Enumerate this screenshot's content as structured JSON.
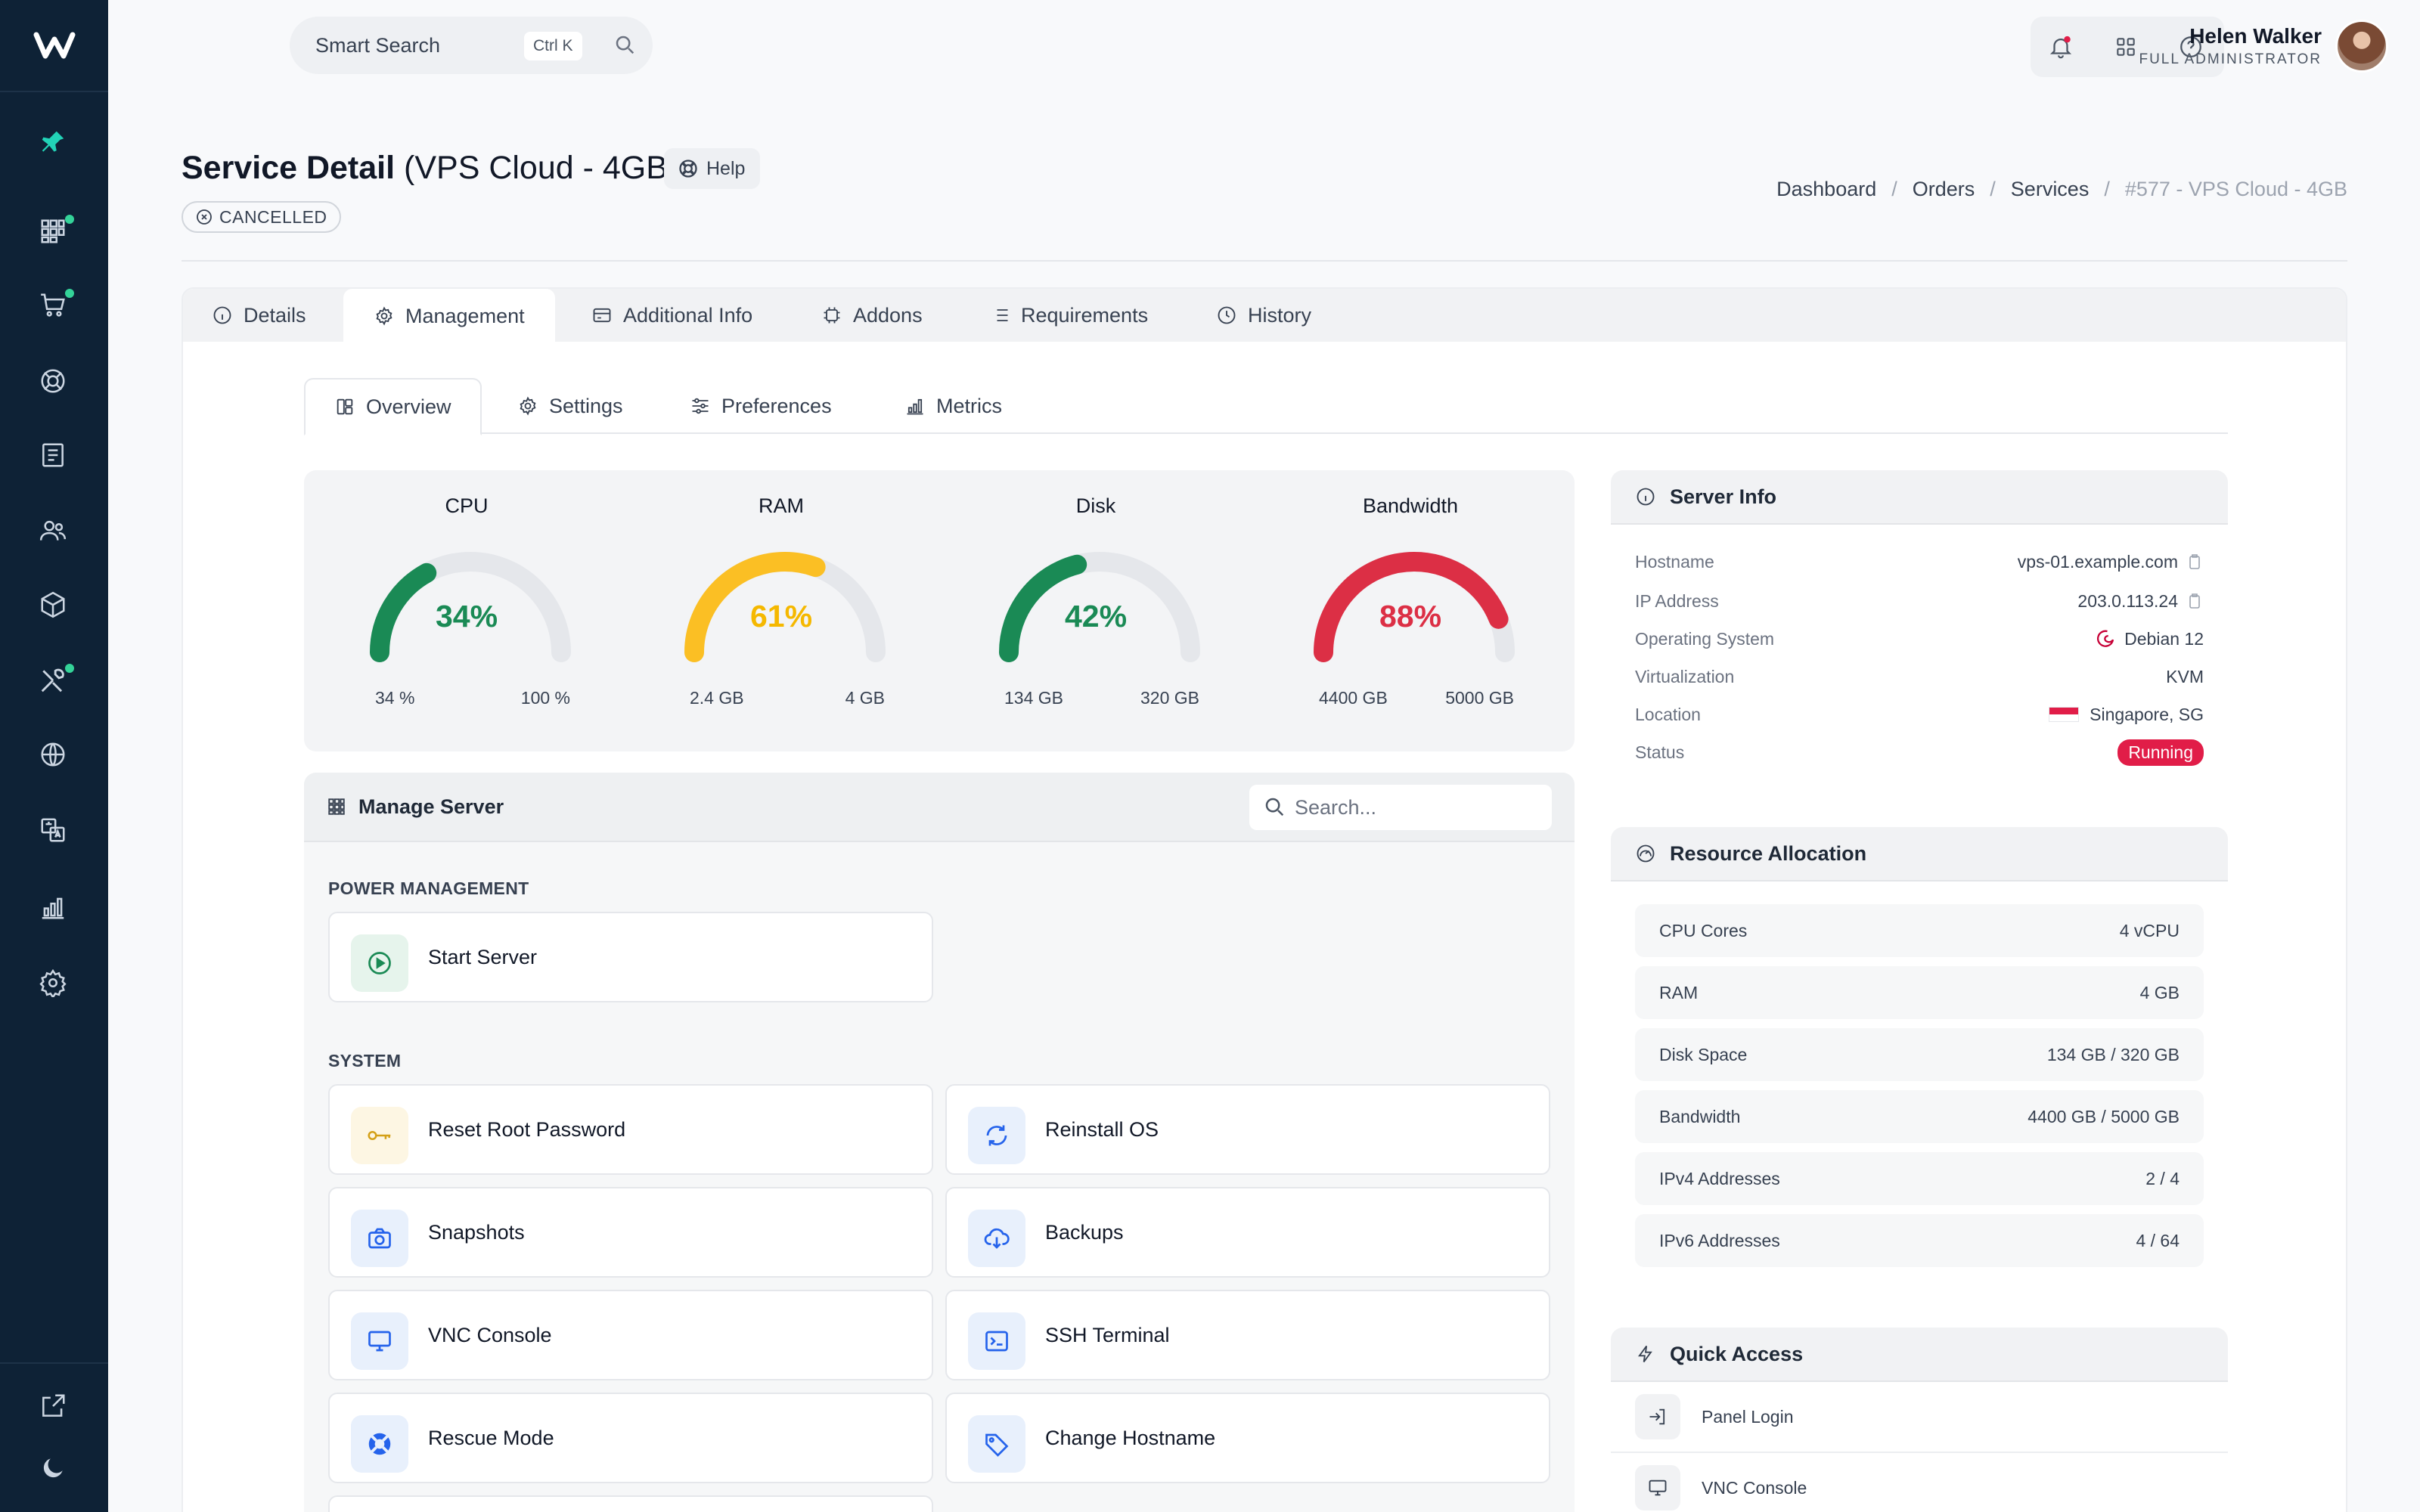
{
  "topbar": {
    "search_placeholder": "Smart Search",
    "search_shortcut": "Ctrl K",
    "user_name": "Helen Walker",
    "user_role": "FULL ADMINISTRATOR"
  },
  "page": {
    "title": "Service Detail",
    "title_suffix": "(VPS Cloud - 4GB)",
    "help_label": "Help",
    "status": "CANCELLED"
  },
  "breadcrumb": [
    "Dashboard",
    "Orders",
    "Services",
    "#577 - VPS Cloud - 4GB"
  ],
  "tabs": [
    {
      "label": "Details",
      "icon": "info-icon"
    },
    {
      "label": "Management",
      "icon": "gear-icon"
    },
    {
      "label": "Additional Info",
      "icon": "card-icon"
    },
    {
      "label": "Addons",
      "icon": "chip-icon"
    },
    {
      "label": "Requirements",
      "icon": "list-icon"
    },
    {
      "label": "History",
      "icon": "clock-icon"
    }
  ],
  "subtabs": [
    {
      "label": "Overview",
      "icon": "layout-icon"
    },
    {
      "label": "Settings",
      "icon": "gear-icon"
    },
    {
      "label": "Preferences",
      "icon": "sliders-icon"
    },
    {
      "label": "Metrics",
      "icon": "bar-chart-icon"
    }
  ],
  "gauges": [
    {
      "title": "CPU",
      "value_text": "34%",
      "percent": 34,
      "min": "34 %",
      "max": "100 %",
      "color": "#1a8a55"
    },
    {
      "title": "RAM",
      "value_text": "61%",
      "percent": 61,
      "min": "2.4 GB",
      "max": "4 GB",
      "color": "#fbbf24"
    },
    {
      "title": "Disk",
      "value_text": "42%",
      "percent": 42,
      "min": "134 GB",
      "max": "320 GB",
      "color": "#1a8a55"
    },
    {
      "title": "Bandwidth",
      "value_text": "88%",
      "percent": 88,
      "min": "4400 GB",
      "max": "5000 GB",
      "color": "#dc2f45"
    }
  ],
  "manage": {
    "title": "Manage Server",
    "search_placeholder": "Search...",
    "section_power": "POWER MANAGEMENT",
    "section_system": "SYSTEM",
    "power_actions": [
      {
        "label": "Start Server",
        "icon": "play-icon",
        "bg": "#e6f4ec",
        "fg": "#1a8a55"
      }
    ],
    "system_actions": [
      {
        "label": "Reset Root Password",
        "icon": "key-icon",
        "bg": "#fdf6e3",
        "fg": "#d4a017"
      },
      {
        "label": "Reinstall OS",
        "icon": "refresh-icon",
        "bg": "#e8f0fc",
        "fg": "#2563eb"
      },
      {
        "label": "Snapshots",
        "icon": "camera-icon",
        "bg": "#e8f0fc",
        "fg": "#2563eb"
      },
      {
        "label": "Backups",
        "icon": "cloud-download-icon",
        "bg": "#e8f0fc",
        "fg": "#2563eb"
      },
      {
        "label": "VNC Console",
        "icon": "monitor-icon",
        "bg": "#e8f0fc",
        "fg": "#2563eb"
      },
      {
        "label": "SSH Terminal",
        "icon": "terminal-icon",
        "bg": "#e8f0fc",
        "fg": "#2563eb"
      },
      {
        "label": "Rescue Mode",
        "icon": "lifebuoy-icon",
        "bg": "#e8f0fc",
        "fg": "#2563eb"
      },
      {
        "label": "Change Hostname",
        "icon": "tag-icon",
        "bg": "#e8f0fc",
        "fg": "#2563eb"
      }
    ]
  },
  "server_info": {
    "title": "Server Info",
    "rows": [
      {
        "key": "Hostname",
        "value": "vps-01.example.com"
      },
      {
        "key": "IP Address",
        "value": "203.0.113.24"
      },
      {
        "key": "Operating System",
        "value": "Debian 12"
      },
      {
        "key": "Virtualization",
        "value": "KVM"
      },
      {
        "key": "Location",
        "value": "Singapore, SG"
      },
      {
        "key": "Status",
        "value": "Running"
      }
    ]
  },
  "resources": {
    "title": "Resource Allocation",
    "rows": [
      {
        "key": "CPU Cores",
        "value": "4 vCPU"
      },
      {
        "key": "RAM",
        "value": "4 GB"
      },
      {
        "key": "Disk Space",
        "value": "134 GB / 320 GB"
      },
      {
        "key": "Bandwidth",
        "value": "4400 GB / 5000 GB"
      },
      {
        "key": "IPv4 Addresses",
        "value": "2 / 4"
      },
      {
        "key": "IPv6 Addresses",
        "value": "4 / 64"
      }
    ]
  },
  "quick_access": {
    "title": "Quick Access",
    "items": [
      {
        "label": "Panel Login",
        "icon": "login-icon"
      },
      {
        "label": "VNC Console",
        "icon": "monitor-icon"
      }
    ]
  }
}
